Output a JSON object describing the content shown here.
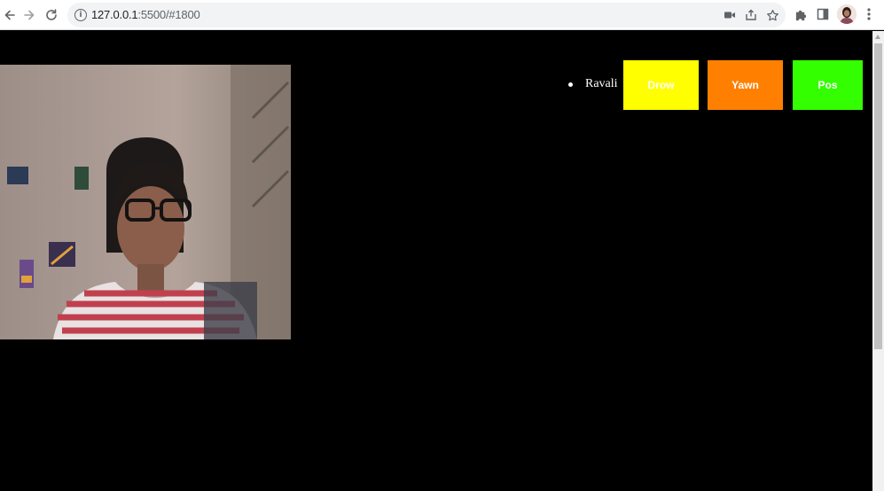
{
  "browser": {
    "url_host": "127.0.0.1",
    "url_rest": ":5500/#1800",
    "icons": {
      "back": "arrow-left-icon",
      "forward": "arrow-right-icon",
      "reload": "reload-icon",
      "site_info": "info-icon",
      "camera": "camera-icon",
      "share": "share-icon",
      "bookmark": "star-icon",
      "extensions": "puzzle-icon",
      "side_panel": "side-panel-icon",
      "menu": "kebab-menu-icon"
    }
  },
  "users": [
    {
      "name": "Ravali"
    }
  ],
  "state_buttons": [
    {
      "label": "Drow",
      "color": "#ffff00"
    },
    {
      "label": "Yawn",
      "color": "#ff8000"
    },
    {
      "label": "Pos",
      "color": "#33ff00"
    }
  ],
  "colors": {
    "page_background": "#000000",
    "toolbar_background": "#ffffff",
    "omnibox_background": "#f1f3f4"
  }
}
